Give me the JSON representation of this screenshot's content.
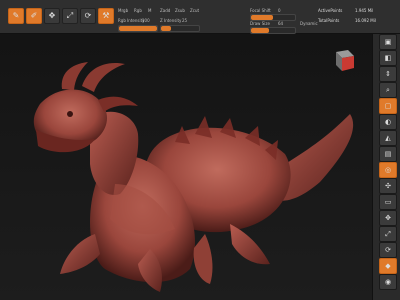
{
  "toolbar": {
    "buttons": [
      {
        "name": "edit-button",
        "icon": "edit-icon"
      },
      {
        "name": "draw-button",
        "icon": "draw-icon"
      },
      {
        "name": "move-button",
        "icon": "move-icon"
      },
      {
        "name": "scale-button",
        "icon": "scale-icon"
      },
      {
        "name": "rotate-button",
        "icon": "rotate-icon"
      },
      {
        "name": "brush-button",
        "icon": "brush-icon"
      }
    ],
    "mrgb_label": "Mrgb",
    "rgb_label": "Rgb",
    "m_label": "M",
    "zadd_label": "Zadd",
    "zsub_label": "Zsub",
    "zcut_label": "Zcut",
    "rgb_intensity_label": "Rgb Intensity",
    "z_intensity_label": "Z Intensity",
    "focal_shift_label": "Focal Shift",
    "draw_size_label": "Draw Size",
    "dynamic_label": "Dynamic",
    "active_points_label": "ActivePoints",
    "total_points_label": "TotalPoints",
    "rgb_intensity_value": "100",
    "z_intensity_value": "25",
    "focal_shift_value": "0",
    "draw_size_value": "64",
    "active_points_value": "1.945 Mil",
    "total_points_value": "16.092 Mil"
  },
  "viewport": {
    "subject": "dragon turtle sculpt",
    "colors": {
      "sculpt": "#b5564a",
      "shadow": "#5a221d",
      "background": "#171717",
      "accent": "#e07a2a"
    }
  },
  "rightbar": {
    "items": [
      {
        "name": "bpr-button",
        "icon": "bpr-icon",
        "active": false
      },
      {
        "name": "spix-button",
        "icon": "spix-icon",
        "active": false
      },
      {
        "name": "scroll-button",
        "icon": "scroll-icon",
        "active": false
      },
      {
        "name": "zoom-button",
        "icon": "zoom-icon",
        "active": false
      },
      {
        "name": "actual-button",
        "icon": "actual-icon",
        "active": true
      },
      {
        "name": "aahalf-button",
        "icon": "aahalf-icon",
        "active": false
      },
      {
        "name": "persp-button",
        "icon": "persp-icon",
        "active": false
      },
      {
        "name": "floor-button",
        "icon": "floor-icon",
        "active": false
      },
      {
        "name": "local-button",
        "icon": "local-icon",
        "active": true
      },
      {
        "name": "xyz-button",
        "icon": "xyz-icon",
        "active": false
      },
      {
        "name": "frame-button",
        "icon": "frame-icon",
        "active": false
      },
      {
        "name": "move-view-button",
        "icon": "move-icon",
        "active": false
      },
      {
        "name": "scale-view-button",
        "icon": "scale-icon",
        "active": false
      },
      {
        "name": "rotate-view-button",
        "icon": "rotate-icon",
        "active": false
      },
      {
        "name": "linefill-button",
        "icon": "linefill-icon",
        "active": false
      },
      {
        "name": "transp-button",
        "icon": "transp-icon",
        "active": false
      },
      {
        "name": "dynamic-persp-button",
        "icon": "dynamic-icon",
        "active": true
      },
      {
        "name": "solo-button",
        "icon": "solo-icon",
        "active": false
      }
    ]
  }
}
